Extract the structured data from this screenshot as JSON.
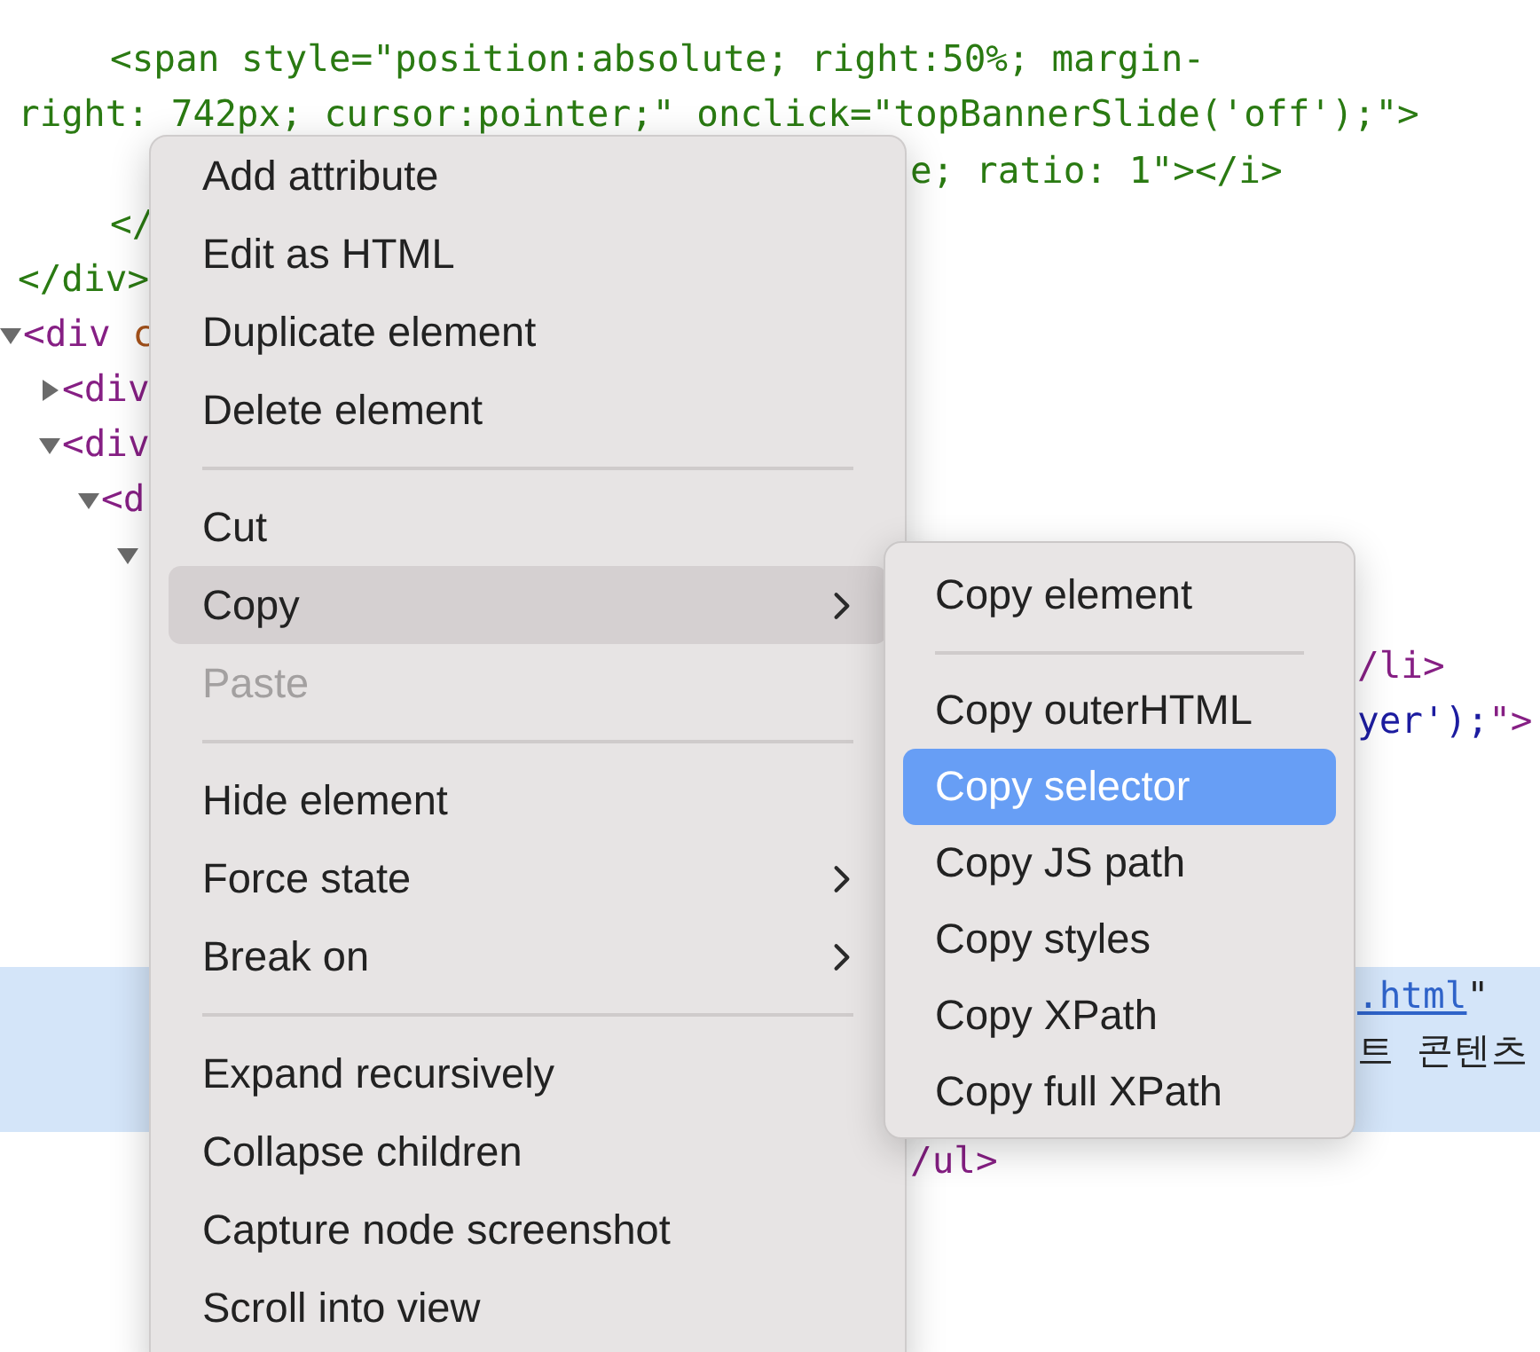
{
  "code": {
    "lines": [
      {
        "kind": "gap"
      },
      {
        "kind": "indented",
        "segments": [
          {
            "kind": "comment",
            "text": "<span style=\"position:absolute; right:50%; margin-"
          }
        ]
      },
      {
        "kind": "plain",
        "segments": [
          {
            "kind": "comment",
            "text": "right: 742px; cursor:pointer;\" onclick=\"topBannerSlide('off');\">"
          }
        ]
      },
      {
        "kind": "plain",
        "right": {
          "kind": "after-menu",
          "segments": [
            {
              "kind": "comment",
              "text": "e; ratio: 1\"></i>"
            }
          ]
        }
      },
      {
        "kind": "indented",
        "segments": [
          {
            "kind": "comment",
            "text": "</"
          }
        ]
      },
      {
        "kind": "plain",
        "segments": [
          {
            "kind": "comment",
            "text": "</div>"
          }
        ]
      },
      {
        "kind": "tree",
        "nodes": [
          {
            "expanded": true,
            "segments": [
              {
                "kind": "tag",
                "text": "<div "
              },
              {
                "kind": "attr",
                "text": "c"
              }
            ],
            "children": [
              {
                "expanded": false,
                "segments": [
                  {
                    "kind": "tag",
                    "text": "<div"
                  }
                ]
              },
              {
                "expanded": true,
                "segments": [
                  {
                    "kind": "tag",
                    "text": "<div"
                  }
                ],
                "children": [
                  {
                    "expanded": true,
                    "segments": [
                      {
                        "kind": "tag",
                        "text": "<d"
                      }
                    ],
                    "children": [
                      {
                        "expanded": true
                      }
                    ]
                  }
                ]
              }
            ]
          }
        ]
      },
      {
        "kind": "gap"
      },
      {
        "kind": "plain",
        "right": {
          "kind": "after-submenu",
          "segments": [
            {
              "kind": "tag",
              "text": "/li>"
            }
          ]
        }
      },
      {
        "kind": "plain",
        "right": {
          "kind": "after-submenu",
          "segments": [
            {
              "kind": "value",
              "text": "yer');"
            },
            {
              "kind": "tag",
              "text": "\">"
            }
          ]
        }
      },
      {
        "kind": "gap"
      },
      {
        "kind": "gap"
      },
      {
        "kind": "gap"
      },
      {
        "kind": "gap"
      },
      {
        "kind": "plain",
        "selected": true,
        "right": {
          "kind": "after-submenu",
          "segments": [
            {
              "kind": "link",
              "text": ".html"
            },
            {
              "kind": "text",
              "text": "\""
            }
          ]
        }
      },
      {
        "kind": "plain",
        "selected": true,
        "right": {
          "kind": "after-submenu",
          "segments": [
            {
              "kind": "text",
              "text": "트 콘텐츠"
            }
          ]
        }
      },
      {
        "kind": "gap",
        "selected": true
      },
      {
        "kind": "plain",
        "right": {
          "kind": "after-menu",
          "segments": [
            {
              "kind": "tag",
              "text": "/ul>"
            }
          ]
        }
      }
    ]
  },
  "context_menu": {
    "items": [
      {
        "kind": "item",
        "label": "Add attribute"
      },
      {
        "kind": "item",
        "label": "Edit as HTML"
      },
      {
        "kind": "item",
        "label": "Duplicate element"
      },
      {
        "kind": "item",
        "label": "Delete element"
      },
      {
        "kind": "separator"
      },
      {
        "kind": "item",
        "label": "Cut"
      },
      {
        "kind": "item",
        "label": "Copy",
        "selected": true,
        "submenu": true,
        "children": [
          {
            "kind": "item",
            "label": "Copy element",
            "selected": false
          },
          {
            "kind": "separator"
          },
          {
            "kind": "item",
            "label": "Copy outerHTML",
            "selected": false
          },
          {
            "kind": "item",
            "label": "Copy selector",
            "selected": true
          },
          {
            "kind": "item",
            "label": "Copy JS path",
            "selected": false
          },
          {
            "kind": "item",
            "label": "Copy styles",
            "selected": false
          },
          {
            "kind": "item",
            "label": "Copy XPath",
            "selected": false
          },
          {
            "kind": "item",
            "label": "Copy full XPath",
            "selected": false
          }
        ]
      },
      {
        "kind": "item",
        "label": "Paste",
        "disabled": true
      },
      {
        "kind": "separator"
      },
      {
        "kind": "item",
        "label": "Hide element"
      },
      {
        "kind": "item",
        "label": "Force state",
        "submenu": true
      },
      {
        "kind": "item",
        "label": "Break on",
        "submenu": true
      },
      {
        "kind": "separator"
      },
      {
        "kind": "item",
        "label": "Expand recursively"
      },
      {
        "kind": "item",
        "label": "Collapse children"
      },
      {
        "kind": "item",
        "label": "Capture node screenshot"
      },
      {
        "kind": "item",
        "label": "Scroll into view"
      }
    ]
  }
}
